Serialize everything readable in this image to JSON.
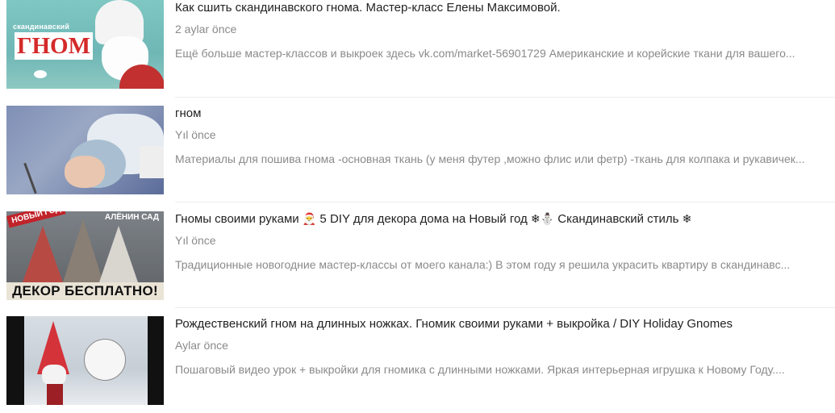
{
  "results": [
    {
      "title": "Как сшить скандинавского гнома. Мастер-класс Елены Максимовой.",
      "date": "2 aylar önce",
      "description": "Ещё больше мастер-классов и выкроек здесь vk.com/market-56901729 Американские и корейские ткани для вашего...",
      "thumb_small": "скандинавский",
      "thumb_big": "ГНОМ"
    },
    {
      "title": "гном",
      "date": "Yıl önce",
      "description": "Материалы для пошива гнома -основная ткань (у меня футер ,можно флис или фетр) -ткань для колпака и рукавичек..."
    },
    {
      "title_part1": "Гномы своими руками ",
      "title_emoji1": "🎅",
      "title_part2": " 5 DIY для декора дома на Новый год ",
      "title_emoji2": "❄⛄",
      "title_part3": " Скандинавский стиль ",
      "title_emoji3": "❄",
      "date": "Yıl önce",
      "description": "Традиционные новогодние мастер-классы от моего канала:) В этом году я решила украсить квартиру в скандинавс...",
      "thumb_left": "НОВЫЙ ГОД",
      "thumb_right": "АЛЁНИН САД",
      "thumb_banner": "ДЕКОР БЕСПЛАТНО!"
    },
    {
      "title": "Рождественский гном на длинных ножках. Гномик своими руками + выкройка / DIY Holiday Gnomes",
      "date": "Aylar önce",
      "description": "Пошаговый видео урок + выкройки для гномика с длинными ножками. Яркая интерьерная игрушка к Новому Году...."
    }
  ]
}
